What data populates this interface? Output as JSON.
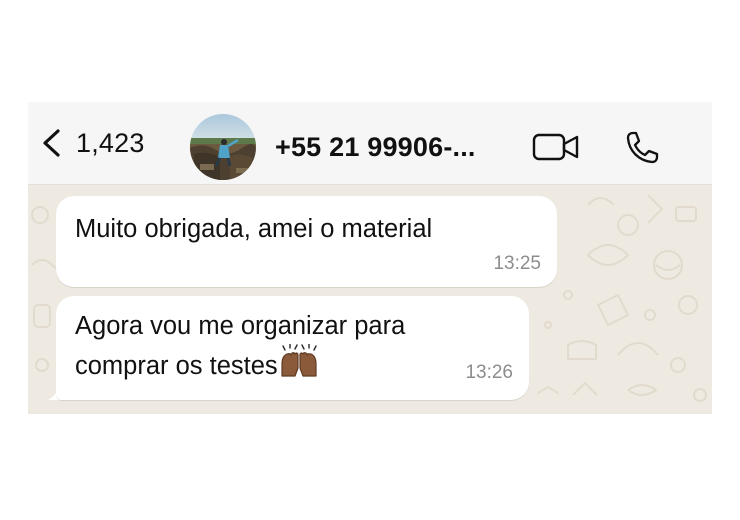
{
  "header": {
    "unread_count": "1,423",
    "contact_name": "+55 21 99906-...",
    "icons": [
      "chevron-left-icon",
      "video-camera-icon",
      "phone-icon"
    ]
  },
  "messages": [
    {
      "text_lines": [
        "Muito obrigada, amei o material"
      ],
      "time": "13:25"
    },
    {
      "text_lines": [
        "Agora vou me organizar para",
        "comprar os testes"
      ],
      "emoji": "raising-hands-emoji",
      "time": "13:26"
    }
  ],
  "colors": {
    "header_bg": "#f6f6f6",
    "chat_bg": "#efeae1",
    "bubble_bg": "#ffffff",
    "timestamp": "#8c8c8c"
  }
}
